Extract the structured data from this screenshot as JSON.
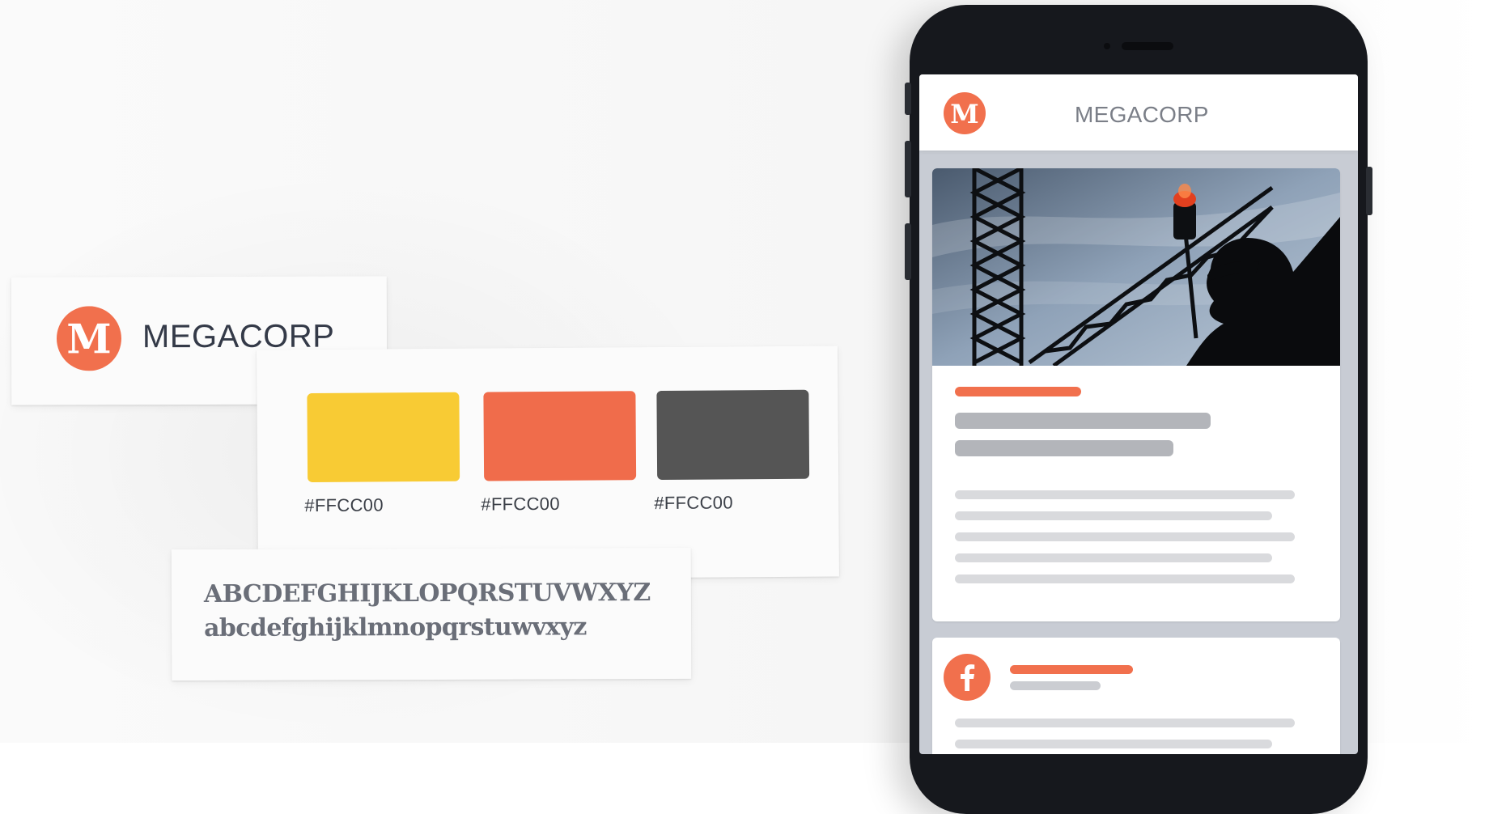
{
  "brand": {
    "name": "MEGACORP",
    "logo_letter": "M",
    "logo_color": "#F1704D"
  },
  "palette": {
    "swatches": [
      {
        "color": "#F8CB34",
        "label": "#FFCC00"
      },
      {
        "color": "#F06C4B",
        "label": "#FFCC00"
      },
      {
        "color": "#555555",
        "label": "#FFCC00"
      }
    ]
  },
  "typography": {
    "uppercase": "ABCDEFGHIJKLOPQRSTUVWXYZ",
    "lowercase": "abcdefghijklmnopqrstuwvxyz"
  },
  "phone_app": {
    "title": "MEGACORP",
    "hero_image": "construction-worker-silhouette-with-crane",
    "social_icon": "facebook-icon",
    "accent_color": "#F1704D"
  }
}
